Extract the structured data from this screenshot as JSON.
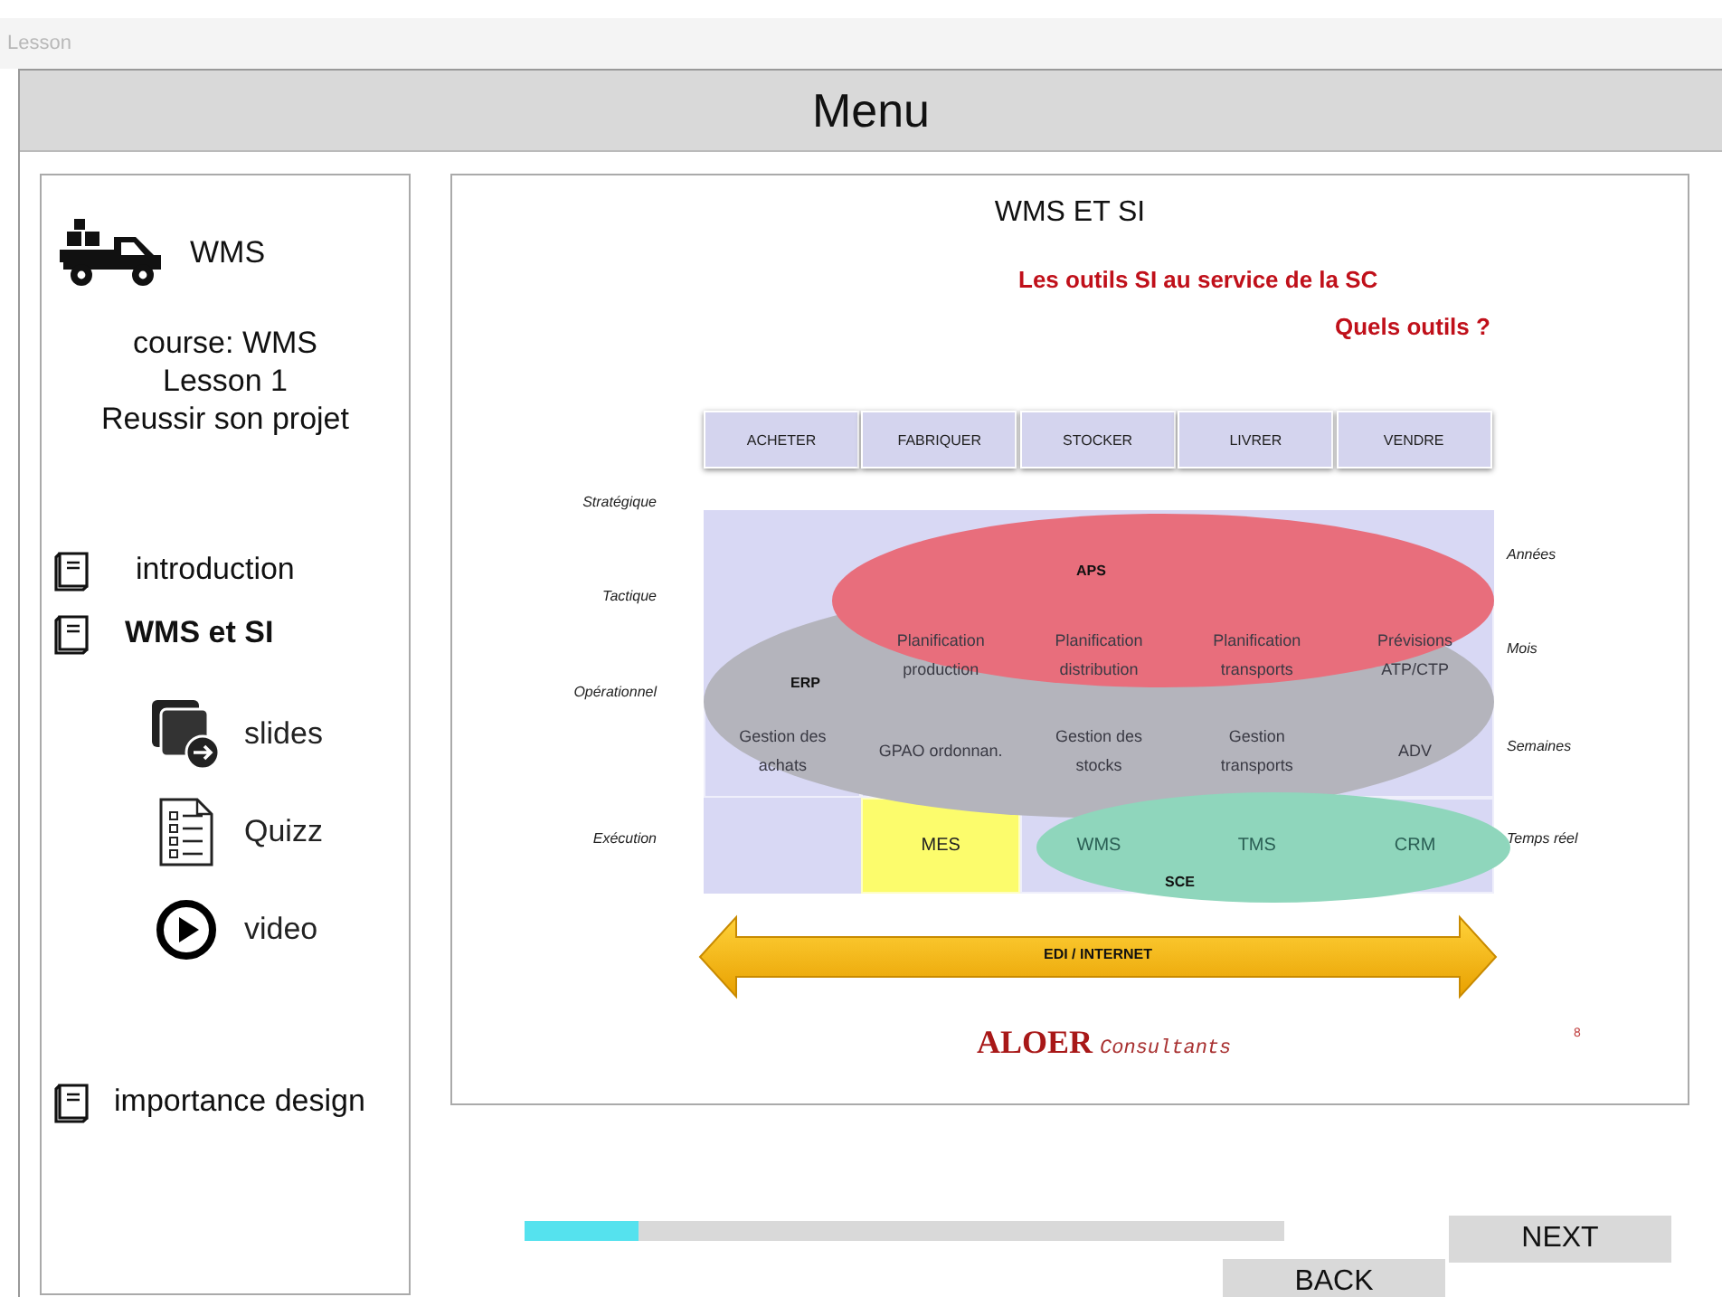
{
  "window": {
    "title": "Lesson"
  },
  "header": {
    "title": "Menu"
  },
  "sidebar": {
    "course_title": "WMS",
    "course_info": [
      "course: WMS",
      "Lesson 1",
      "Reussir son projet"
    ],
    "items": [
      {
        "label": "introduction",
        "kind": "chapter",
        "selected": false
      },
      {
        "label": "WMS et SI",
        "kind": "chapter",
        "selected": true,
        "children": [
          {
            "label": "slides",
            "kind": "slides",
            "selected": false
          },
          {
            "label": "Quizz",
            "kind": "quiz",
            "selected": false
          },
          {
            "label": "video",
            "kind": "video",
            "selected": false
          }
        ]
      },
      {
        "label": "importance design",
        "kind": "chapter",
        "selected": false
      }
    ]
  },
  "slide": {
    "title": "WMS ET SI",
    "subtitle": "Les outils SI au service de la SC",
    "question": "Quels outils ?",
    "columns": [
      "ACHETER",
      "FABRIQUER",
      "STOCKER",
      "LIVRER",
      "VENDRE"
    ],
    "levels": [
      "Stratégique",
      "Tactique",
      "Opérationnel",
      "Exécution"
    ],
    "horizons": [
      "Années",
      "Mois",
      "Semaines",
      "Temps réel"
    ],
    "planning_cells": [
      "Planification production",
      "Planification distribution",
      "Planification transports",
      "Prévisions ATP/CTP"
    ],
    "operations_cells": [
      "Gestion des achats",
      "GPAO ordonnan.",
      "Gestion des stocks",
      "Gestion transports",
      "ADV"
    ],
    "execution_cells": [
      {
        "text": "MES",
        "highlighted": true
      },
      {
        "text": "WMS",
        "highlighted": false
      },
      {
        "text": "TMS",
        "highlighted": false
      },
      {
        "text": "CRM",
        "highlighted": false
      }
    ],
    "regions": [
      {
        "label": "ERP",
        "color": "#b4b4bc"
      },
      {
        "label": "APS",
        "color": "#e86e7c"
      },
      {
        "label": "SCE",
        "color": "#8fd6bc"
      }
    ],
    "arrow_label": "EDI / INTERNET",
    "logo": {
      "brand": "ALOER",
      "suffix": "Consultants"
    },
    "page_number": "8"
  },
  "progress": {
    "level": 0.15
  },
  "buttons": [
    {
      "label": "NEXT",
      "kind": "next"
    },
    {
      "label": "BACK",
      "kind": "back"
    }
  ]
}
